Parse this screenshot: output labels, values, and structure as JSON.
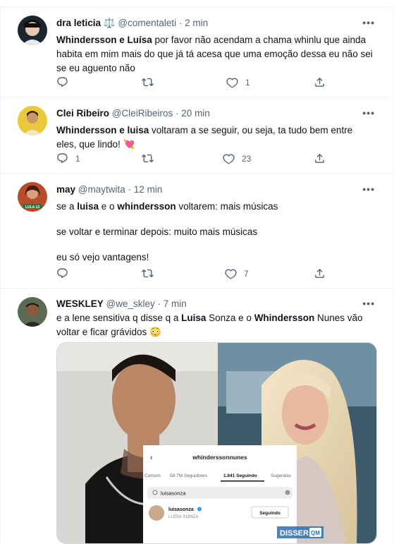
{
  "tweets": [
    {
      "name": "dra leticia",
      "badge": "⚖️",
      "handle": "@comentaleti",
      "sep": "·",
      "time": "2 min",
      "text_parts": [
        {
          "t": "Whindersson e Luísa",
          "b": true
        },
        {
          "t": " por favor não acendam a chama whinlu que ainda habita em mim mais do que já tá acesa que uma emoção dessa eu não sei se eu aguento não",
          "b": false
        }
      ],
      "reply_count": "",
      "retweet_count": "",
      "like_count": "1"
    },
    {
      "name": "Clei Ribeiro",
      "handle": "@CleiRibeiros",
      "sep": "·",
      "time": "20 min",
      "text_parts": [
        {
          "t": "Whindersson e luisa",
          "b": true
        },
        {
          "t": " voltaram a se seguir, ou seja, ta tudo bem entre eles, que lindo! 💘",
          "b": false
        }
      ],
      "reply_count": "1",
      "retweet_count": "",
      "like_count": "23"
    },
    {
      "name": "may",
      "handle": "@maytwita",
      "sep": "·",
      "time": "12 min",
      "lines": [
        [
          {
            "t": "se a ",
            "b": false
          },
          {
            "t": "luisa",
            "b": true
          },
          {
            "t": " e o ",
            "b": false
          },
          {
            "t": "whindersson",
            "b": true
          },
          {
            "t": " voltarem: mais músicas",
            "b": false
          }
        ],
        [
          {
            "t": "se voltar e terminar depois: muito mais músicas",
            "b": false
          }
        ],
        [
          {
            "t": "eu só vejo vantagens!",
            "b": false
          }
        ]
      ],
      "reply_count": "",
      "retweet_count": "",
      "like_count": "7"
    },
    {
      "name": "WESKLEY",
      "handle": "@we_skley",
      "sep": "·",
      "time": "7 min",
      "text_parts": [
        {
          "t": "e a lene sensitiva q disse q a ",
          "b": false
        },
        {
          "t": "Luisa",
          "b": true
        },
        {
          "t": " Sonza e o ",
          "b": false
        },
        {
          "t": "Whindersson",
          "b": true
        },
        {
          "t": " Nunes vão voltar e ficar grávidos 😳",
          "b": false
        }
      ]
    }
  ],
  "embedded": {
    "profile_handle": "whinderssonnunes",
    "tab_comum": "Comum",
    "tab_followers": "58,7M Seguidores",
    "tab_following": "1.841 Seguindo",
    "tab_suggest": "Sugeridas",
    "search_value": "luisasonza",
    "result_user": "luisasonza",
    "result_name": "LUÍSA SONZA",
    "follow_button": "Seguindo",
    "watermark": "DISSER",
    "watermark_badge": "QM",
    "avatar_tag": "LULA 13"
  },
  "more_label": "•••",
  "colors": {
    "text": "#0f1419",
    "muted": "#536471",
    "divider": "#eff3f4",
    "like_heart": "#e0245e"
  }
}
